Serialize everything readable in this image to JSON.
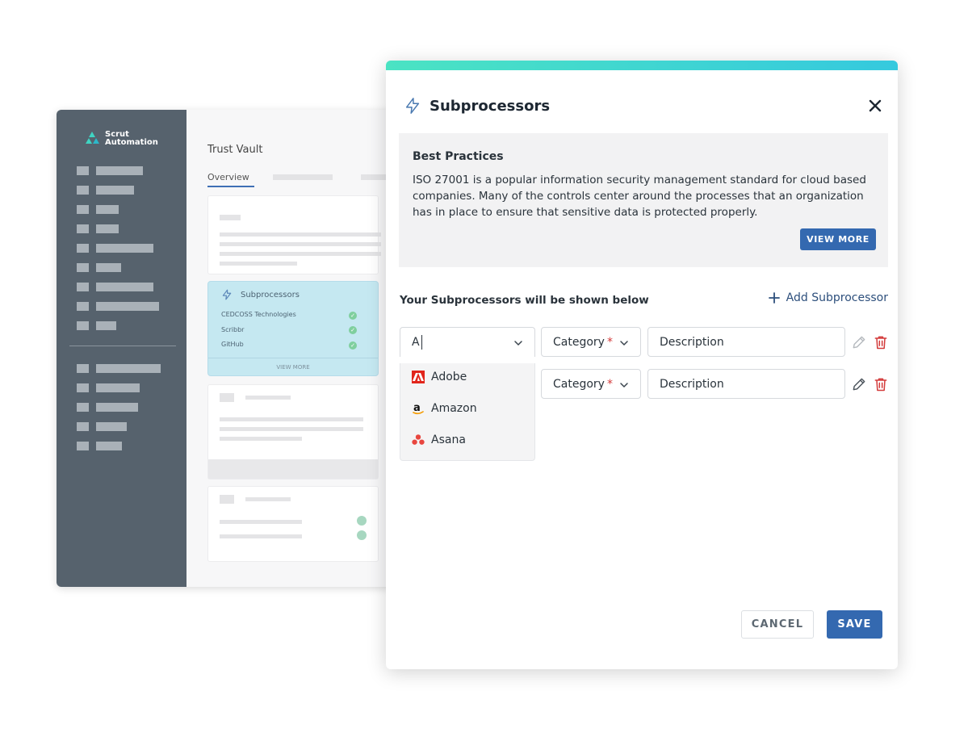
{
  "background": {
    "logo": {
      "line1": "Scrut",
      "line2": "Automation"
    },
    "page_title": "Trust Vault",
    "active_tab": "Overview",
    "subprocessors_card": {
      "title": "Subprocessors",
      "items": [
        "CEDCOSS Technologies",
        "Scribbr",
        "GitHub"
      ],
      "footer": "VIEW MORE"
    }
  },
  "modal": {
    "title": "Subprocessors",
    "best_practices": {
      "title": "Best Practices",
      "body": "ISO 27001 is a popular information security management standard for cloud based companies. Many of the controls center around the processes that an organization has in place to ensure that sensitive data is protected properly.",
      "button": "VIEW MORE"
    },
    "section_label": "Your Subprocessors will be shown below",
    "add_label": "Add Subprocessor",
    "rows": [
      {
        "name_value": "A",
        "category_label": "Category",
        "required_mark": "*",
        "description_label": "Description"
      },
      {
        "category_label": "Category",
        "required_mark": "*",
        "description_label": "Description"
      }
    ],
    "dropdown_options": [
      "Adobe",
      "Amazon",
      "Asana"
    ],
    "cancel": "CANCEL",
    "save": "SAVE"
  },
  "colors": {
    "accent": "#3469b0",
    "gradient_start": "#4be3c3",
    "gradient_end": "#35c9de",
    "danger": "#d33a3a"
  }
}
